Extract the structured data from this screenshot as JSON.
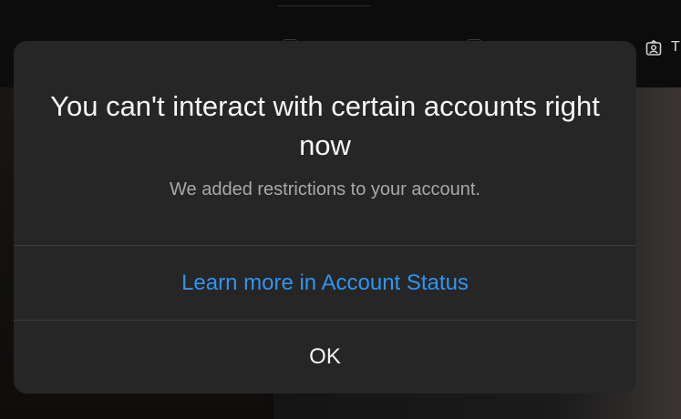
{
  "background": {
    "tab_letter": "T"
  },
  "modal": {
    "title": "You can't interact with certain accounts right now",
    "subtitle": "We added restrictions to your account.",
    "learn_more_label": "Learn more in Account Status",
    "ok_label": "OK"
  },
  "colors": {
    "modal_bg": "#262626",
    "link_blue": "#2f95f0",
    "title_text": "#f5f5f5",
    "subtitle_text": "#a8a8a8"
  }
}
